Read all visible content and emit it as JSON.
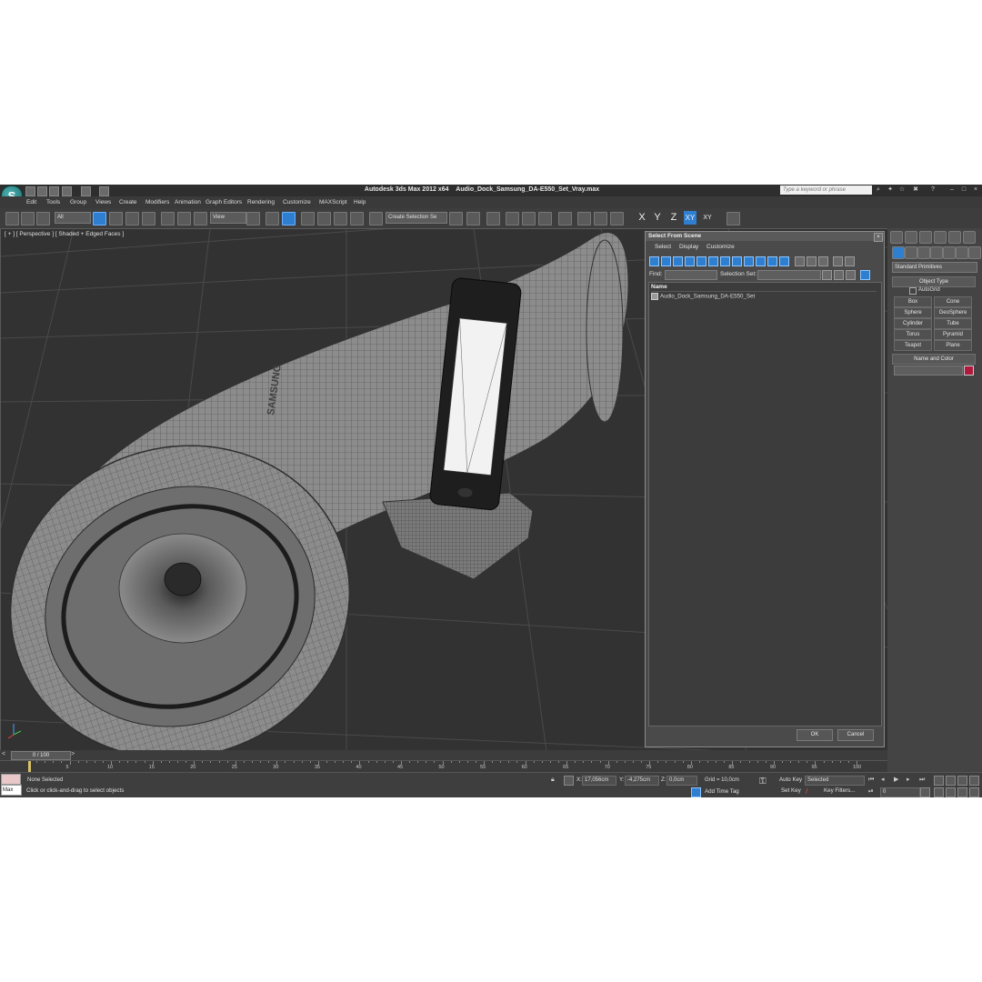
{
  "titlebar": {
    "app_title": "Autodesk 3ds Max  2012 x64",
    "file_name": "Audio_Dock_Samsung_DA-E550_Set_Vray.max",
    "search_placeholder": "Type a keyword or phrase"
  },
  "menu": [
    "Edit",
    "Tools",
    "Group",
    "Views",
    "Create",
    "Modifiers",
    "Animation",
    "Graph Editors",
    "Rendering",
    "Customize",
    "MAXScript",
    "Help"
  ],
  "toolbar": {
    "selection_filter": "All",
    "reference_coord": "View",
    "named_selection_set": "Create Selection Se",
    "axis_x": "X",
    "axis_y": "Y",
    "axis_z": "Z",
    "axis_xy": "XY",
    "axis_xy2": "XY"
  },
  "viewport": {
    "label": "[ + ] [ Perspective ] [ Shaded + Edged Faces ]",
    "brand_text": "SAMSUNG"
  },
  "command_panel": {
    "category": "Standard Primitives",
    "object_type_title": "Object Type",
    "autogrid_label": "AutoGrid",
    "objects": [
      "Box",
      "Cone",
      "Sphere",
      "GeoSphere",
      "Cylinder",
      "Tube",
      "Torus",
      "Pyramid",
      "Teapot",
      "Plane"
    ],
    "name_color_title": "Name and Color",
    "swatch_color": "#b0193c"
  },
  "dialog": {
    "title": "Select From Scene",
    "menu": [
      "Select",
      "Display",
      "Customize"
    ],
    "find_label": "Find:",
    "selection_set_label": "Selection Set:",
    "column_header": "Name",
    "items": [
      "Audio_Dock_Samsung_DA-E550_Set"
    ],
    "ok": "OK",
    "cancel": "Cancel"
  },
  "timeline": {
    "frame_counter": "0 / 100",
    "ticks": [
      "5",
      "10",
      "15",
      "20",
      "25",
      "30",
      "35",
      "40",
      "45",
      "50",
      "55",
      "60",
      "65",
      "70",
      "75",
      "80",
      "85",
      "90",
      "95",
      "100"
    ]
  },
  "status": {
    "maxscript_label": "Max",
    "selection_status": "None Selected",
    "prompt": "Click or click-and-drag to select objects",
    "x_label": "X:",
    "x_value": "17,056cm",
    "y_label": "Y:",
    "y_value": "-4,275cm",
    "z_label": "Z:",
    "z_value": "0,0cm",
    "grid": "Grid = 10,0cm",
    "add_time_tag": "Add Time Tag",
    "auto_key": "Auto Key",
    "set_key": "Set Key",
    "key_mode": "Selected",
    "key_filters": "Key Filters...",
    "current_frame": "0"
  }
}
